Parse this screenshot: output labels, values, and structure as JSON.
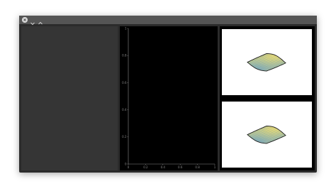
{
  "window": {
    "titlebar_icons": [
      "close-icon",
      "minimize-icon",
      "maximize-icon"
    ]
  },
  "chart_data": {
    "type": "line",
    "series": [],
    "x_ticks": [
      "0",
      "0.2",
      "0.4",
      "0.6",
      "0.8",
      "1"
    ],
    "y_ticks": [
      "0",
      "0.2",
      "0.4",
      "0.6",
      "0.8",
      "1"
    ],
    "xlim": [
      0,
      1
    ],
    "ylim": [
      0,
      1
    ],
    "background": "#000000",
    "axis_color": "#8a8a8a"
  },
  "surface_views": [
    {
      "icon": "surface-3d-icon"
    },
    {
      "icon": "surface-3d-icon"
    }
  ]
}
